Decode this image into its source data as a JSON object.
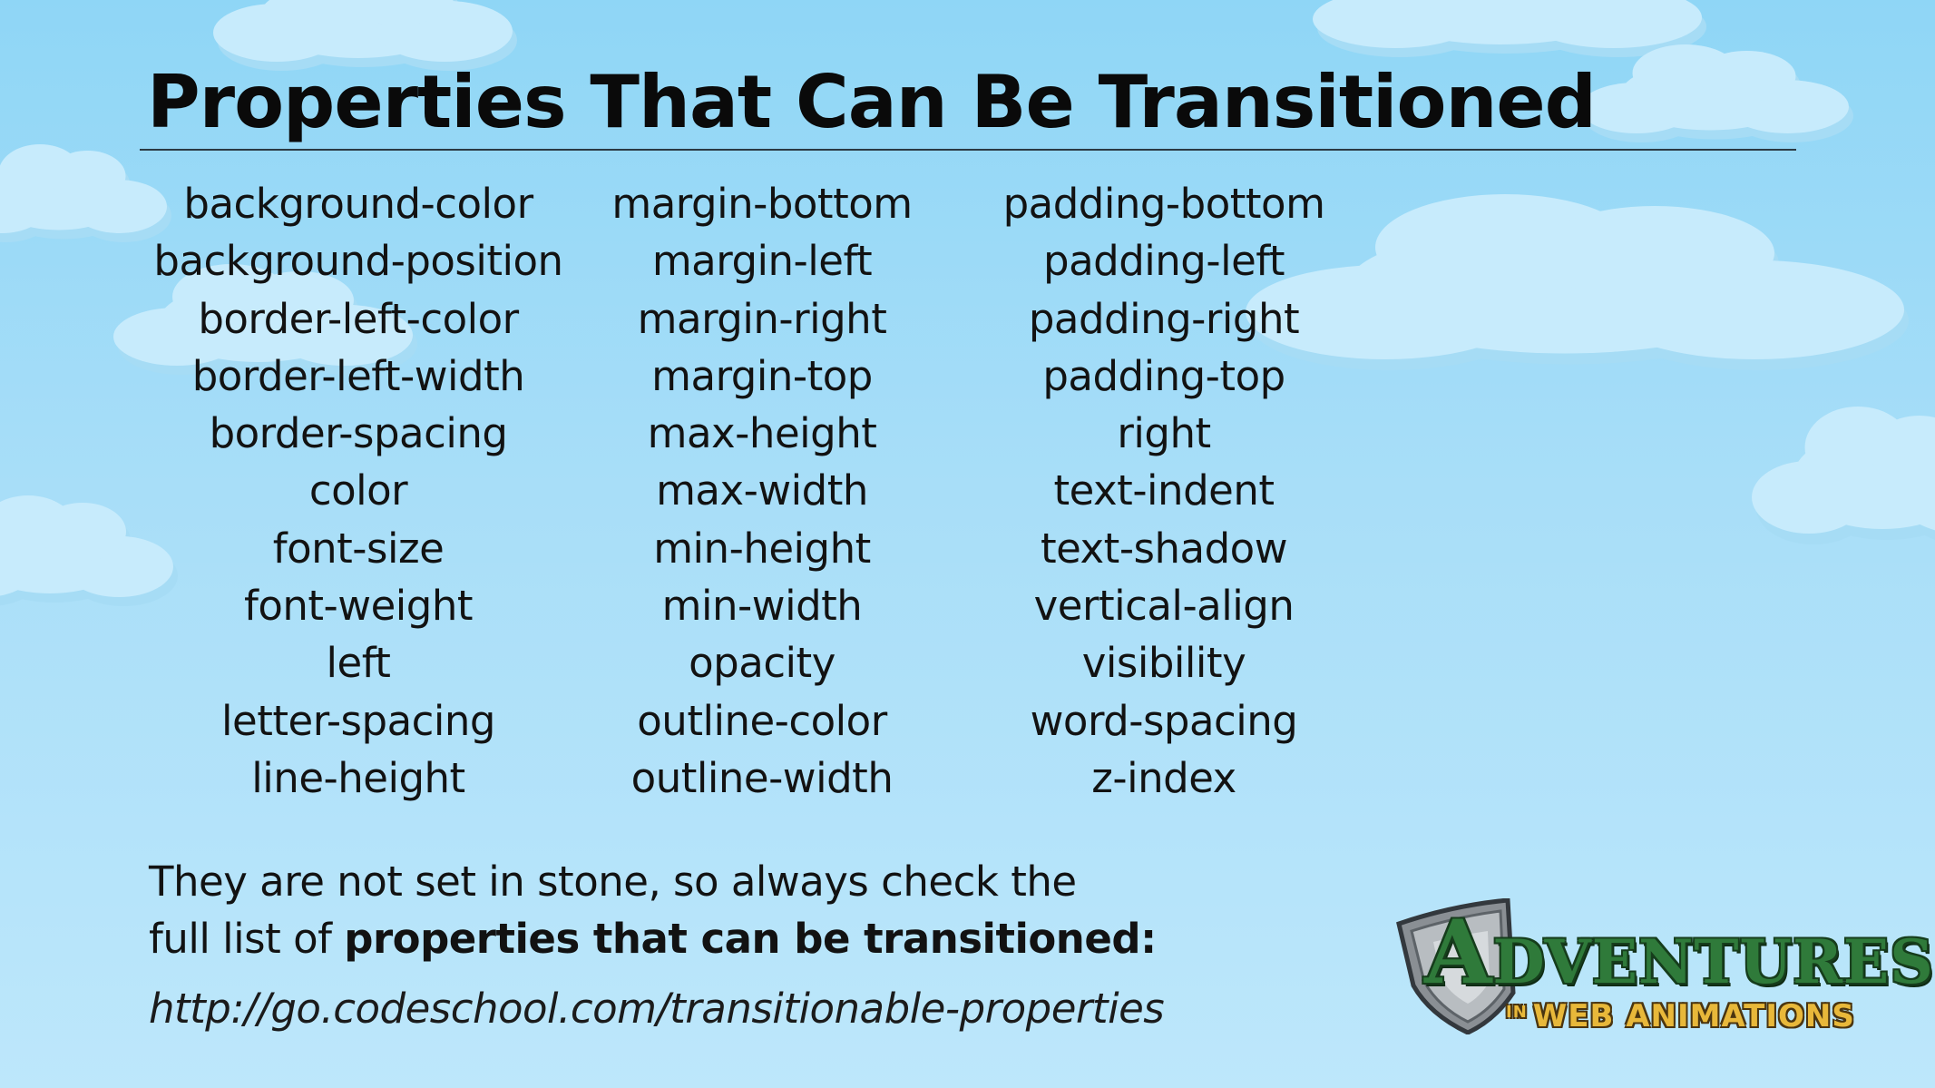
{
  "slide": {
    "title": "Properties That Can Be Transitioned",
    "columns": [
      [
        "background-color",
        "background-position",
        "border-left-color",
        "border-left-width",
        "border-spacing",
        "color",
        "font-size",
        "font-weight",
        "left",
        "letter-spacing",
        "line-height"
      ],
      [
        "margin-bottom",
        "margin-left",
        "margin-right",
        "margin-top",
        "max-height",
        "max-width",
        "min-height",
        "min-width",
        "opacity",
        "outline-color",
        "outline-width"
      ],
      [
        "padding-bottom",
        "padding-left",
        "padding-right",
        "padding-top",
        "right",
        "text-indent",
        "text-shadow",
        "vertical-align",
        "visibility",
        "word-spacing",
        "z-index"
      ]
    ],
    "note": {
      "line1": "They are not set in stone, so always check the",
      "line2_prefix": "full list of ",
      "line2_bold": "properties that can be transitioned:"
    },
    "url": "http://go.codeschool.com/transitionable-properties"
  },
  "logo": {
    "title_first": "A",
    "title_rest": "DVENTURES",
    "subtitle_in": "IN",
    "subtitle": "WEB ANIMATIONS"
  },
  "colors": {
    "sky_top": "#8fd6f6",
    "sky_bottom": "#bde7fb",
    "cloud": "#c7ebfc",
    "text": "#121212",
    "logo_green": "#2f7a3a",
    "logo_gold": "#e8b83a"
  }
}
